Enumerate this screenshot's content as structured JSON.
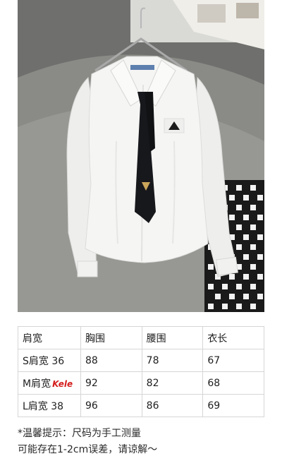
{
  "photo": {
    "description_icon": "product-photo-white-shirt-black-tie",
    "colors": {
      "sofa": "#7a7a78",
      "shirt": "#f4f4f2",
      "tie": "#15161a",
      "wall": "#d8d8d6"
    }
  },
  "size_table": {
    "headers": [
      "肩宽",
      "胸围",
      "腰围",
      "衣长"
    ],
    "rows": [
      {
        "size": "S肩宽 36",
        "chest": "88",
        "waist": "78",
        "length": "67",
        "watermark": ""
      },
      {
        "size": "M肩宽",
        "chest": "92",
        "waist": "82",
        "length": "68",
        "watermark": "Kele"
      },
      {
        "size": "L肩宽 38",
        "chest": "96",
        "waist": "86",
        "length": "69",
        "watermark": ""
      }
    ]
  },
  "notes": {
    "line1": "*温馨提示：尺码为手工测量",
    "line2": "可能存在1-2cm误差，请谅解～"
  }
}
